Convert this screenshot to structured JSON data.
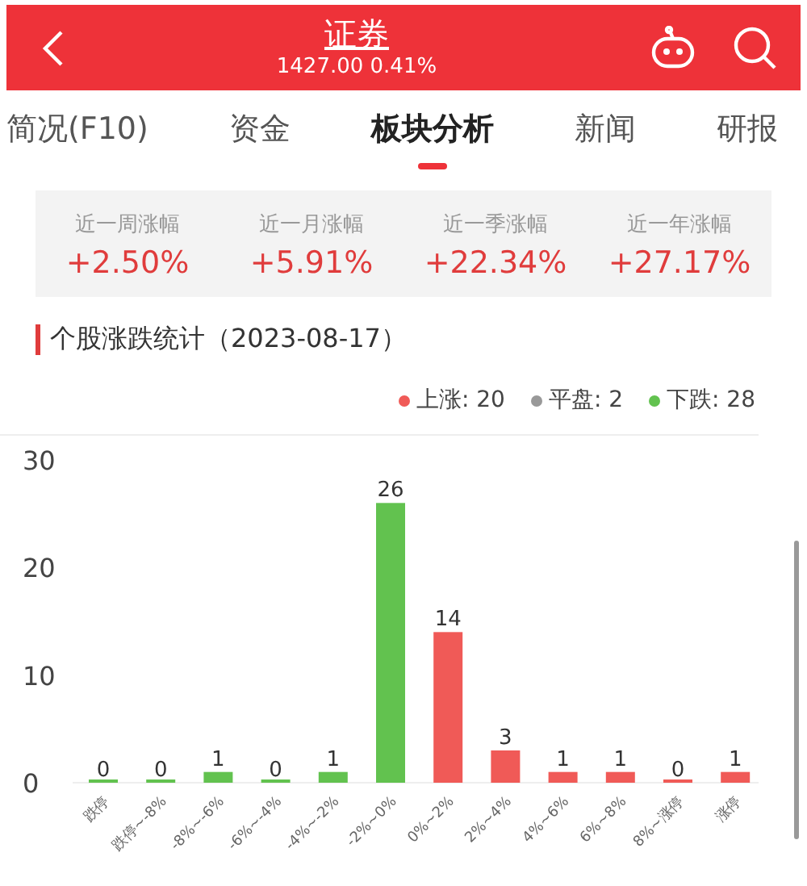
{
  "header": {
    "title": "证券",
    "subtitle": "1427.00 0.41%"
  },
  "tabs": [
    {
      "label": "简况(F10)",
      "selected": false
    },
    {
      "label": "资金",
      "selected": false
    },
    {
      "label": "板块分析",
      "selected": true
    },
    {
      "label": "新闻",
      "selected": false
    },
    {
      "label": "研报",
      "selected": false
    }
  ],
  "stats": [
    {
      "label": "近一周涨幅",
      "value": "+2.50%"
    },
    {
      "label": "近一月涨幅",
      "value": "+5.91%"
    },
    {
      "label": "近一季涨幅",
      "value": "+22.34%"
    },
    {
      "label": "近一年涨幅",
      "value": "+27.17%"
    }
  ],
  "section": {
    "title": "个股涨跌统计（2023-08-17）"
  },
  "legend": [
    {
      "label": "上涨: 20",
      "color": "#f05a57"
    },
    {
      "label": "平盘: 2",
      "color": "#999999"
    },
    {
      "label": "下跌: 28",
      "color": "#62c24f"
    }
  ],
  "chart_data": {
    "type": "bar",
    "stacked": true,
    "data_labels": true,
    "categories": [
      "跌停",
      "跌停~-8%",
      "-8%~-6%",
      "-6%~-4%",
      "-4%~-2%",
      "-2%~0%",
      "0%~2%",
      "2%~4%",
      "4%~6%",
      "6%~8%",
      "8%~涨停",
      "涨停"
    ],
    "ylim": [
      0,
      30
    ],
    "yticks": [
      0,
      10,
      20,
      30
    ],
    "series": [
      {
        "color": "#62c24f",
        "values": [
          0,
          0,
          1,
          0,
          1,
          26,
          null,
          null,
          null,
          null,
          null,
          null
        ]
      },
      {
        "color": "#f05a57",
        "values": [
          null,
          null,
          null,
          null,
          null,
          null,
          14,
          3,
          1,
          1,
          0,
          1
        ]
      }
    ]
  }
}
